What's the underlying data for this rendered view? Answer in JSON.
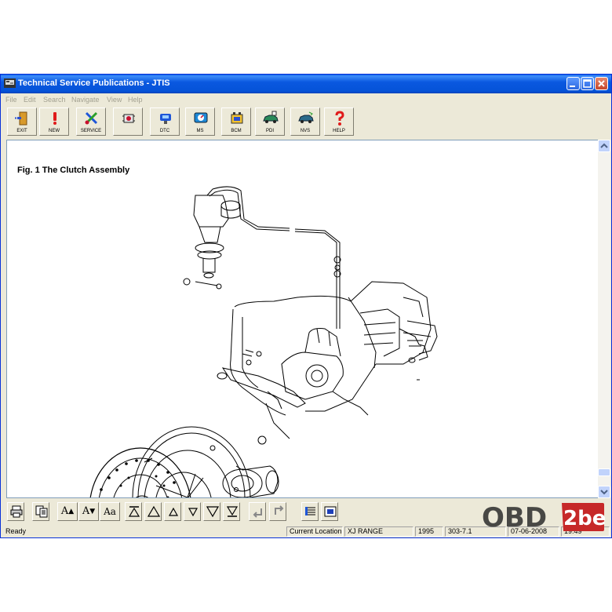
{
  "window": {
    "title": "Technical Service Publications - JTIS"
  },
  "menu": [
    "File",
    "Edit",
    "Search",
    "Navigate",
    "View",
    "Help"
  ],
  "toolbar": [
    {
      "label": "EXIT",
      "icon": "exit-door-icon"
    },
    {
      "label": "NEW",
      "icon": "exclamation-icon"
    },
    {
      "label": "SERVICE",
      "icon": "wrench-screwdriver-icon"
    },
    {
      "label": "",
      "icon": "gear-module-icon"
    },
    {
      "label": "DTC",
      "icon": "dtc-diagnostic-icon"
    },
    {
      "label": "MS",
      "icon": "meter-icon"
    },
    {
      "label": "BCM",
      "icon": "battery-module-icon"
    },
    {
      "label": "PDI",
      "icon": "car-inspection-icon"
    },
    {
      "label": "NVS",
      "icon": "car-icon"
    },
    {
      "label": "HELP",
      "icon": "question-icon"
    }
  ],
  "document": {
    "figure_title": "Fig. 1 The Clutch Assembly"
  },
  "bottom_toolbar": {
    "font_increase": "A",
    "font_decrease": "A",
    "font_style": "Aa"
  },
  "status": {
    "text": "Ready",
    "location_label": "Current Location",
    "location_value": "XJ RANGE",
    "year": "1995",
    "section": "303-7.1",
    "date": "07-06-2008",
    "time": "19:49"
  },
  "watermark": {
    "text_left": "OBD",
    "text_right": "2be"
  },
  "colors": {
    "title_bar": "#0a58e0",
    "window_face": "#ece9d8",
    "status_accent": "#c62828"
  }
}
